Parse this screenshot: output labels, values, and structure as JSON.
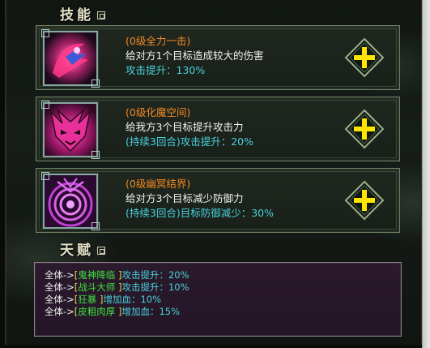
{
  "sections": {
    "skills_title": "技能",
    "talents_title": "天赋"
  },
  "skills": [
    {
      "name": "(0级全力一击)",
      "desc": "给对方1个目标造成较大的伤害",
      "bonus": "攻击提升：130%",
      "icon": "strike-icon",
      "icon_color": "#ff3a8a"
    },
    {
      "name": "(0级化魔空间)",
      "desc": "给我方3个目标提升攻击力",
      "bonus": "(持续3回合)攻击提升：20%",
      "icon": "demon-mask-icon",
      "icon_color": "#e8309a"
    },
    {
      "name": "(0级幽冥结界)",
      "desc": "给对方3个目标减少防御力",
      "bonus": "(持续3回合)目标防御减少：30%",
      "icon": "barrier-rings-icon",
      "icon_color": "#c040d0"
    }
  ],
  "talents": [
    {
      "prefix": "全体->",
      "name": "鬼神降临",
      "effect": "攻击提升：",
      "value": "20%"
    },
    {
      "prefix": "全体->",
      "name": "战斗大师",
      "effect": "攻击提升：",
      "value": "10%"
    },
    {
      "prefix": "全体->",
      "name": "狂暴",
      "effect": "增加血：",
      "value": "10%"
    },
    {
      "prefix": "全体->",
      "name": "皮粗肉厚",
      "effect": "增加血：",
      "value": "15%"
    }
  ],
  "colors": {
    "skill_name": "#ef8a24",
    "skill_bonus": "#4ad0dc",
    "talent_name": "#3fe03f",
    "plus_button": "#ffe600"
  }
}
